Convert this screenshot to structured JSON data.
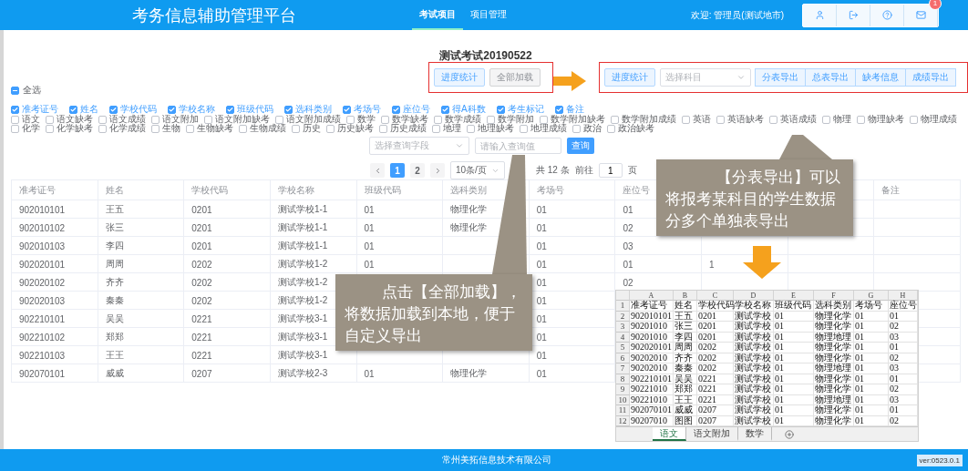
{
  "header": {
    "title": "考务信息辅助管理平台",
    "nav": [
      {
        "label": "考试项目",
        "selected": true
      },
      {
        "label": "项目管理",
        "selected": false
      }
    ],
    "welcome": "欢迎: 管理员(测试地市)",
    "mail_badge": "1"
  },
  "exam_title": "测试考试20190522",
  "load_actions": [
    {
      "label": "进度统计",
      "kind": "primary"
    },
    {
      "label": "全部加载",
      "kind": "plain"
    }
  ],
  "export_actions": {
    "stats_button": "进度统计",
    "subject_select": {
      "placeholder": "选择科目"
    },
    "buttons": [
      "分表导出",
      "总表导出",
      "缺考信息",
      "成绩导出"
    ]
  },
  "select_all": {
    "label": "全选",
    "indeterminate": true
  },
  "basic_fields": [
    {
      "label": "准考证号",
      "checked": true
    },
    {
      "label": "姓名",
      "checked": true
    },
    {
      "label": "学校代码",
      "checked": true
    },
    {
      "label": "学校名称",
      "checked": true
    },
    {
      "label": "班级代码",
      "checked": true
    },
    {
      "label": "选科类别",
      "checked": true
    },
    {
      "label": "考场号",
      "checked": true
    },
    {
      "label": "座位号",
      "checked": true
    },
    {
      "label": "得A科数",
      "checked": true
    },
    {
      "label": "考生标记",
      "checked": true
    },
    {
      "label": "备注",
      "checked": true
    }
  ],
  "subject_fields": [
    {
      "label": "语文",
      "checked": false
    },
    {
      "label": "语文缺考",
      "checked": false
    },
    {
      "label": "语文成绩",
      "checked": false
    },
    {
      "label": "语文附加",
      "checked": false
    },
    {
      "label": "语文附加缺考",
      "checked": false
    },
    {
      "label": "语文附加成绩",
      "checked": false
    },
    {
      "label": "数学",
      "checked": false
    },
    {
      "label": "数学缺考",
      "checked": false
    },
    {
      "label": "数学成绩",
      "checked": false
    },
    {
      "label": "数学附加",
      "checked": false
    },
    {
      "label": "数学附加缺考",
      "checked": false
    },
    {
      "label": "数学附加成绩",
      "checked": false
    },
    {
      "label": "英语",
      "checked": false
    },
    {
      "label": "英语缺考",
      "checked": false
    },
    {
      "label": "英语成绩",
      "checked": false
    },
    {
      "label": "物理",
      "checked": false
    },
    {
      "label": "物理缺考",
      "checked": false
    },
    {
      "label": "物理成绩",
      "checked": false
    },
    {
      "label": "化学",
      "checked": false
    },
    {
      "label": "化学缺考",
      "checked": false
    },
    {
      "label": "化学成绩",
      "checked": false
    },
    {
      "label": "生物",
      "checked": false
    },
    {
      "label": "生物缺考",
      "checked": false
    },
    {
      "label": "生物成绩",
      "checked": false
    },
    {
      "label": "历史",
      "checked": false
    },
    {
      "label": "历史缺考",
      "checked": false
    },
    {
      "label": "历史成绩",
      "checked": false
    },
    {
      "label": "地理",
      "checked": false
    },
    {
      "label": "地理缺考",
      "checked": false
    },
    {
      "label": "地理成绩",
      "checked": false
    },
    {
      "label": "政治",
      "checked": false
    },
    {
      "label": "政治缺考",
      "checked": false
    }
  ],
  "query": {
    "field_placeholder": "选择查询字段",
    "value_placeholder": "请输入查询值",
    "button": "查询"
  },
  "pagination": {
    "pages": [
      {
        "label": "1",
        "selected": true
      },
      {
        "label": "2",
        "selected": false
      }
    ],
    "page_size": "10条/页",
    "total": "共 12 条",
    "goto_label": "前往",
    "goto_value": "1",
    "goto_unit": "页"
  },
  "table": {
    "columns": [
      "准考证号",
      "姓名",
      "学校代码",
      "学校名称",
      "班级代码",
      "选科类别",
      "考场号",
      "座位号",
      null,
      null,
      "备注"
    ],
    "rows": [
      [
        "902010101",
        "王五",
        "0201",
        "测试学校1-1",
        "01",
        "物理化学",
        "01",
        "01",
        null,
        null,
        null
      ],
      [
        "902010102",
        "张三",
        "0201",
        "测试学校1-1",
        "01",
        "物理化学",
        "01",
        "02",
        null,
        null,
        null
      ],
      [
        "902010103",
        "李四",
        "0201",
        "测试学校1-1",
        "01",
        null,
        "01",
        "03",
        null,
        null,
        null
      ],
      [
        "902020101",
        "周周",
        "0202",
        "测试学校1-2",
        "01",
        null,
        "01",
        "01",
        "1",
        null,
        null
      ],
      [
        "902020102",
        "齐齐",
        "0202",
        "测试学校1-2",
        null,
        null,
        "01",
        "02",
        null,
        null,
        null
      ],
      [
        "902020103",
        "秦秦",
        "0202",
        "测试学校1-2",
        null,
        null,
        "01",
        null,
        null,
        null,
        null
      ],
      [
        "902210101",
        "吴吴",
        "0221",
        "测试学校3-1",
        null,
        null,
        "01",
        null,
        null,
        null,
        null
      ],
      [
        "902210102",
        "郑郑",
        "0221",
        "测试学校3-1",
        null,
        null,
        "01",
        null,
        null,
        null,
        null
      ],
      [
        "902210103",
        "王王",
        "0221",
        "测试学校3-1",
        null,
        null,
        "01",
        null,
        null,
        null,
        null
      ],
      [
        "902070101",
        "威威",
        "0207",
        "测试学校2-3",
        "01",
        "物理化学",
        "01",
        null,
        null,
        null,
        null
      ]
    ]
  },
  "callouts": [
    {
      "text": "点击【全部加载】，将数据加载到本地，便于自定义导出"
    },
    {
      "text": "【分表导出】可以将报考某科目的学生数据分多个单独表导出"
    }
  ],
  "excel": {
    "columns": [
      "A",
      "B",
      "C",
      "D",
      "E",
      "F",
      "G",
      "H"
    ],
    "rows": [
      {
        "number": "1",
        "cells": [
          "准考证号",
          "姓名",
          "学校代码",
          "学校名称",
          "班级代码",
          "选科类别",
          "考场号",
          "座位号"
        ]
      },
      {
        "number": "2",
        "cells": [
          "902010101",
          "王五",
          "0201",
          "测试学校",
          "01",
          "物理化学",
          "01",
          "01"
        ]
      },
      {
        "number": "3",
        "cells": [
          "90201010",
          "张三",
          "0201",
          "测试学校",
          "01",
          "物理化学",
          "01",
          "02"
        ]
      },
      {
        "number": "4",
        "cells": [
          "90201010",
          "李四",
          "0201",
          "测试学校",
          "01",
          "物理地理",
          "01",
          "03"
        ]
      },
      {
        "number": "5",
        "cells": [
          "902020101",
          "周周",
          "0202",
          "测试学校",
          "01",
          "物理化学",
          "01",
          "01"
        ]
      },
      {
        "number": "6",
        "cells": [
          "90202010",
          "齐齐",
          "0202",
          "测试学校",
          "01",
          "物理化学",
          "01",
          "02"
        ]
      },
      {
        "number": "7",
        "cells": [
          "90202010",
          "秦秦",
          "0202",
          "测试学校",
          "01",
          "物理地理",
          "01",
          "03"
        ]
      },
      {
        "number": "8",
        "cells": [
          "902210101",
          "吴吴",
          "0221",
          "测试学校",
          "01",
          "物理化学",
          "01",
          "01"
        ]
      },
      {
        "number": "9",
        "cells": [
          "90221010",
          "郑郑",
          "0221",
          "测试学校",
          "01",
          "物理化学",
          "01",
          "02"
        ]
      },
      {
        "number": "10",
        "cells": [
          "90221010",
          "王王",
          "0221",
          "测试学校",
          "01",
          "物理地理",
          "01",
          "03"
        ]
      },
      {
        "number": "11",
        "cells": [
          "902070101",
          "威威",
          "0207",
          "测试学校",
          "01",
          "物理化学",
          "01",
          "01"
        ]
      },
      {
        "number": "12",
        "cells": [
          "90207010",
          "图图",
          "0207",
          "测试学校",
          "01",
          "物理化学",
          "01",
          "02"
        ]
      }
    ],
    "sheets": [
      {
        "label": "语文",
        "selected": true
      },
      {
        "label": "语文附加",
        "selected": false
      },
      {
        "label": "数学",
        "selected": false
      }
    ]
  },
  "footer": {
    "company": "常州美拓信息技术有限公司",
    "version": "ver:0523.0.1"
  }
}
